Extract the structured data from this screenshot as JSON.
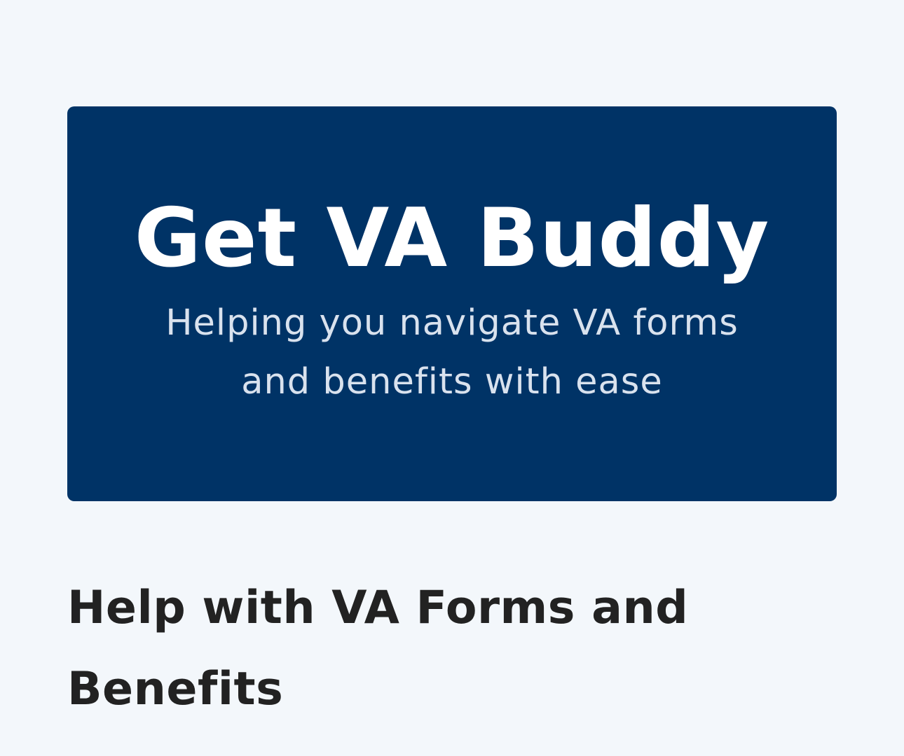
{
  "hero": {
    "title": "Get VA Buddy",
    "subtitle": "Helping you navigate VA forms and benefits with ease",
    "background_color": "#003366",
    "title_color": "#ffffff",
    "subtitle_color": "#d9e2ee"
  },
  "main": {
    "section_title": "Help with VA Forms and Benefits",
    "text_color": "#222222"
  },
  "page": {
    "background_color": "#f3f7fb"
  }
}
